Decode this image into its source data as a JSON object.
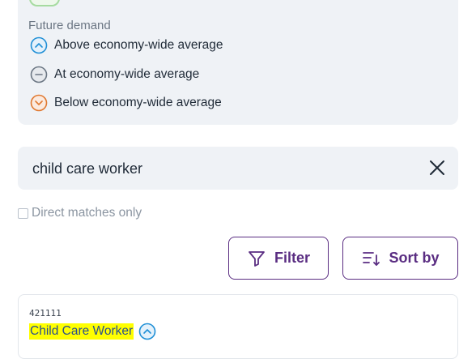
{
  "legend": {
    "heading": "Future demand",
    "items": [
      {
        "label": "Above economy-wide average",
        "icon": "chevron-up-circle-icon",
        "color": "#1f8fd6"
      },
      {
        "label": "At economy-wide average",
        "icon": "minus-circle-icon",
        "color": "#6b7683"
      },
      {
        "label": "Below economy-wide average",
        "icon": "chevron-down-circle-icon",
        "color": "#e0782f"
      }
    ]
  },
  "search": {
    "value": "child care worker",
    "clear_icon": "close-icon"
  },
  "direct_matches": {
    "label": "Direct matches only",
    "checked": false
  },
  "toolbar": {
    "filter_label": "Filter",
    "sort_label": "Sort by",
    "accent": "#5a2d82"
  },
  "results": [
    {
      "code": "421111",
      "title": "Child Care Worker",
      "demand": "above",
      "highlight": "#ffff00"
    }
  ]
}
